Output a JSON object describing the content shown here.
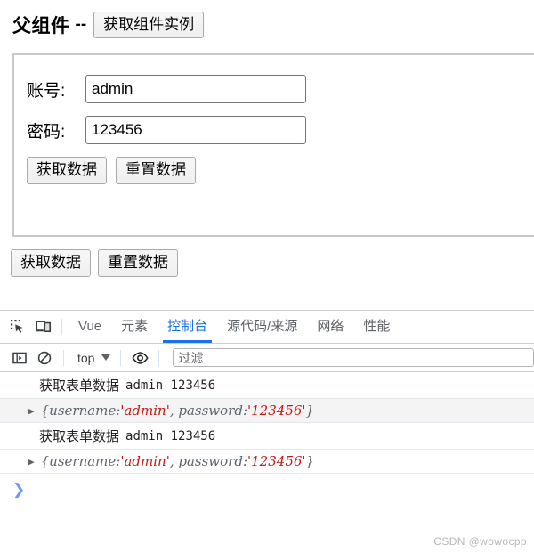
{
  "page": {
    "title": "父组件",
    "dash": "--",
    "get_instance_button": "获取组件实例",
    "form": {
      "username_label": "账号:",
      "username_value": "admin",
      "password_label": "密码:",
      "password_value": "123456",
      "submit_button": "获取数据",
      "reset_button": "重置数据"
    },
    "outer": {
      "submit_button": "获取数据",
      "reset_button": "重置数据"
    }
  },
  "devtools": {
    "icons": {
      "inspect": "inspect-element-icon",
      "device": "device-toolbar-icon",
      "sidebar": "console-sidebar-icon",
      "clear": "clear-console-icon",
      "eye": "live-expression-eye-icon"
    },
    "tabs": [
      {
        "label": "Vue",
        "active": false
      },
      {
        "label": "元素",
        "active": false
      },
      {
        "label": "控制台",
        "active": true
      },
      {
        "label": "源代码/来源",
        "active": false
      },
      {
        "label": "网络",
        "active": false
      },
      {
        "label": "性能",
        "active": false
      }
    ],
    "toolbar": {
      "context": "top",
      "filter_placeholder": "过滤",
      "filter_value": ""
    },
    "console": {
      "rows": [
        {
          "type": "log",
          "cn": "获取表单数据",
          "mono": "admin 123456",
          "shaded": false
        },
        {
          "type": "object",
          "arrow": "▶",
          "prefix": "{username: ",
          "str1": "'admin'",
          "mid": ", password: ",
          "str2": "'123456'",
          "suffix": "}",
          "shaded": true
        },
        {
          "type": "log",
          "cn": "获取表单数据",
          "mono": "admin 123456",
          "shaded": false
        },
        {
          "type": "object",
          "arrow": "▶",
          "prefix": "{username: ",
          "str1": "'admin'",
          "mid": ", password: ",
          "str2": "'123456'",
          "suffix": "}",
          "shaded": false
        }
      ],
      "prompt": "❯"
    }
  },
  "watermark": "CSDN @wowocpp",
  "colors": {
    "accent": "#1a73e8",
    "string": "#c41a16",
    "object": "#5b6570",
    "shaded_row": "#f4f4f4"
  }
}
